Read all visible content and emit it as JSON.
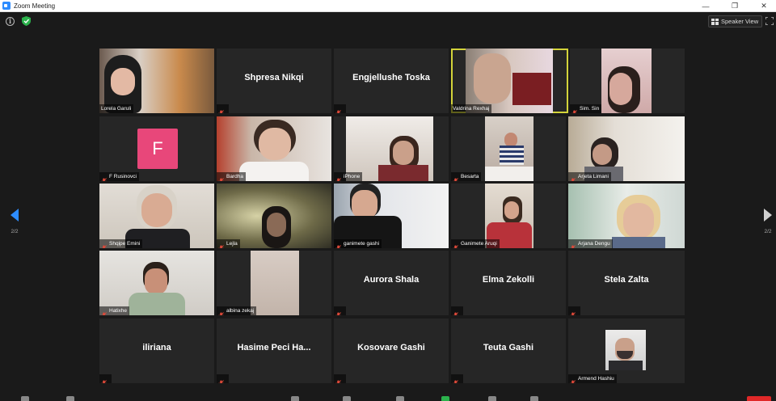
{
  "window": {
    "title": "Zoom Meeting",
    "controls": [
      "—",
      "❐",
      "✕"
    ]
  },
  "topbar": {
    "info_glyph": "i",
    "speaker_view_label": "Speaker View"
  },
  "pagination": {
    "left": "2/2",
    "right": "2/2"
  },
  "colors": {
    "active_speaker": "#d4d43a",
    "mute": "#e04a3a",
    "avatar_f": "#e8477a",
    "shield": "#2bb24c"
  },
  "participants": [
    {
      "name": "Lorela Garuli",
      "video": true,
      "muted": false
    },
    {
      "name": "Shpresa Nikqi",
      "video": false,
      "muted": true
    },
    {
      "name": "Engjellushe Toska",
      "video": false,
      "muted": true
    },
    {
      "name": "Valdrina Rexhaj",
      "video": true,
      "muted": false,
      "active": true
    },
    {
      "name": "Sim. Sin",
      "video": true,
      "muted": true
    },
    {
      "name": "F Rusinovci",
      "video": false,
      "initial": "F",
      "muted": true
    },
    {
      "name": "Bardha",
      "video": true,
      "muted": true
    },
    {
      "name": "iPhone",
      "video": true,
      "muted": true
    },
    {
      "name": "Besarta",
      "video": true,
      "muted": true
    },
    {
      "name": "Arjeta Limani",
      "video": true,
      "muted": true
    },
    {
      "name": "Shqipe Emini",
      "video": true,
      "muted": true
    },
    {
      "name": "Lejla",
      "video": true,
      "muted": true
    },
    {
      "name": "ganimete gashi",
      "video": true,
      "muted": true
    },
    {
      "name": "Ganimete Aruqi",
      "video": true,
      "muted": true
    },
    {
      "name": "Arjana Dengu",
      "video": true,
      "muted": true
    },
    {
      "name": "Hatixhe",
      "video": true,
      "muted": true
    },
    {
      "name": "albina zekaj",
      "video": true,
      "muted": true
    },
    {
      "name": "Aurora Shala",
      "video": false,
      "muted": true
    },
    {
      "name": "Elma Zekolli",
      "video": false,
      "muted": true
    },
    {
      "name": "Stela Zalta",
      "video": false,
      "muted": true
    },
    {
      "name": "iliriana",
      "video": false,
      "muted": true
    },
    {
      "name": "Hasime  Peci  Ha...",
      "video": false,
      "muted": true
    },
    {
      "name": "Kosovare Gashi",
      "video": false,
      "muted": true
    },
    {
      "name": "Teuta Gashi",
      "video": false,
      "muted": true
    },
    {
      "name": "Armend Hashiu",
      "video": true,
      "muted": true
    }
  ]
}
